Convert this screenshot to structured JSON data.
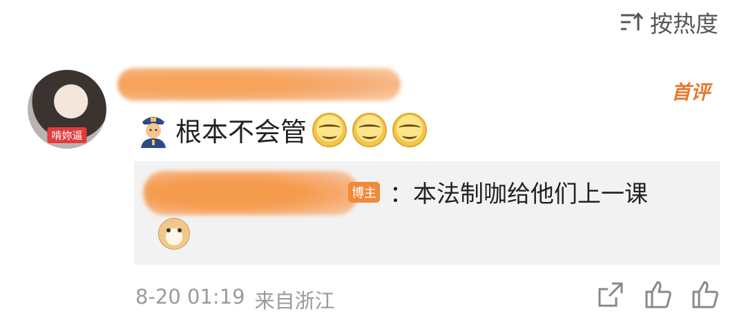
{
  "sort": {
    "label": "按热度",
    "icon": "sort-icon"
  },
  "comment": {
    "avatar_tag": "啃妳逼",
    "first_badge": "首评",
    "text": "根本不会管",
    "emojis": [
      "police-officer-emoji",
      "smirk-emoji",
      "smirk-emoji",
      "smirk-emoji"
    ]
  },
  "reply": {
    "badge": "博主",
    "text": "：本法制咖给他们上一课",
    "emoji": "doge-emoji"
  },
  "footer": {
    "time": "8-20 01:19",
    "location": "来自浙江"
  },
  "actions": [
    "share-icon",
    "like-icon",
    "like-icon"
  ],
  "colors": {
    "accent": "#e8782b",
    "host_badge": "#f08a3b",
    "reply_bg": "#f2f2f2",
    "meta": "#9a9a9a"
  }
}
